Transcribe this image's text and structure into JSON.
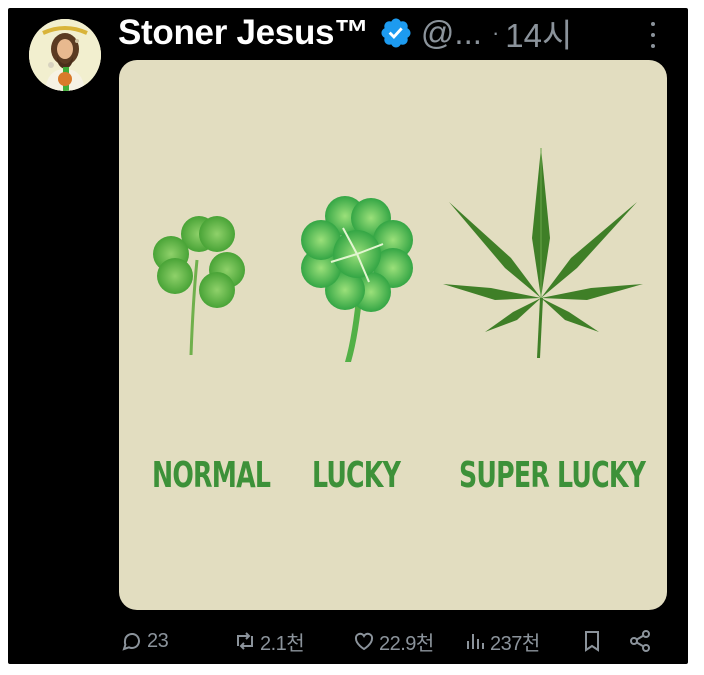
{
  "post": {
    "author_name": "Stoner Jesus™",
    "handle": "@...",
    "separator": "·",
    "time": "14시"
  },
  "media": {
    "labels": {
      "normal": "NORMAL",
      "lucky": "LUCKY",
      "super_lucky": "SUPER LUCKY"
    },
    "colors": {
      "background": "#e2ddc0",
      "label": "#3d9139",
      "clover": "#4fa634",
      "leaf": "#3f7f27"
    }
  },
  "actions": {
    "replies": "23",
    "reposts": "2.1천",
    "likes": "22.9천",
    "views": "237천"
  },
  "icons": {
    "verified": "verified-badge-icon",
    "more": "more-vertical-icon",
    "reply": "reply-icon",
    "repost": "repost-icon",
    "like": "heart-icon",
    "views": "views-icon",
    "bookmark": "bookmark-icon",
    "share": "share-icon"
  }
}
